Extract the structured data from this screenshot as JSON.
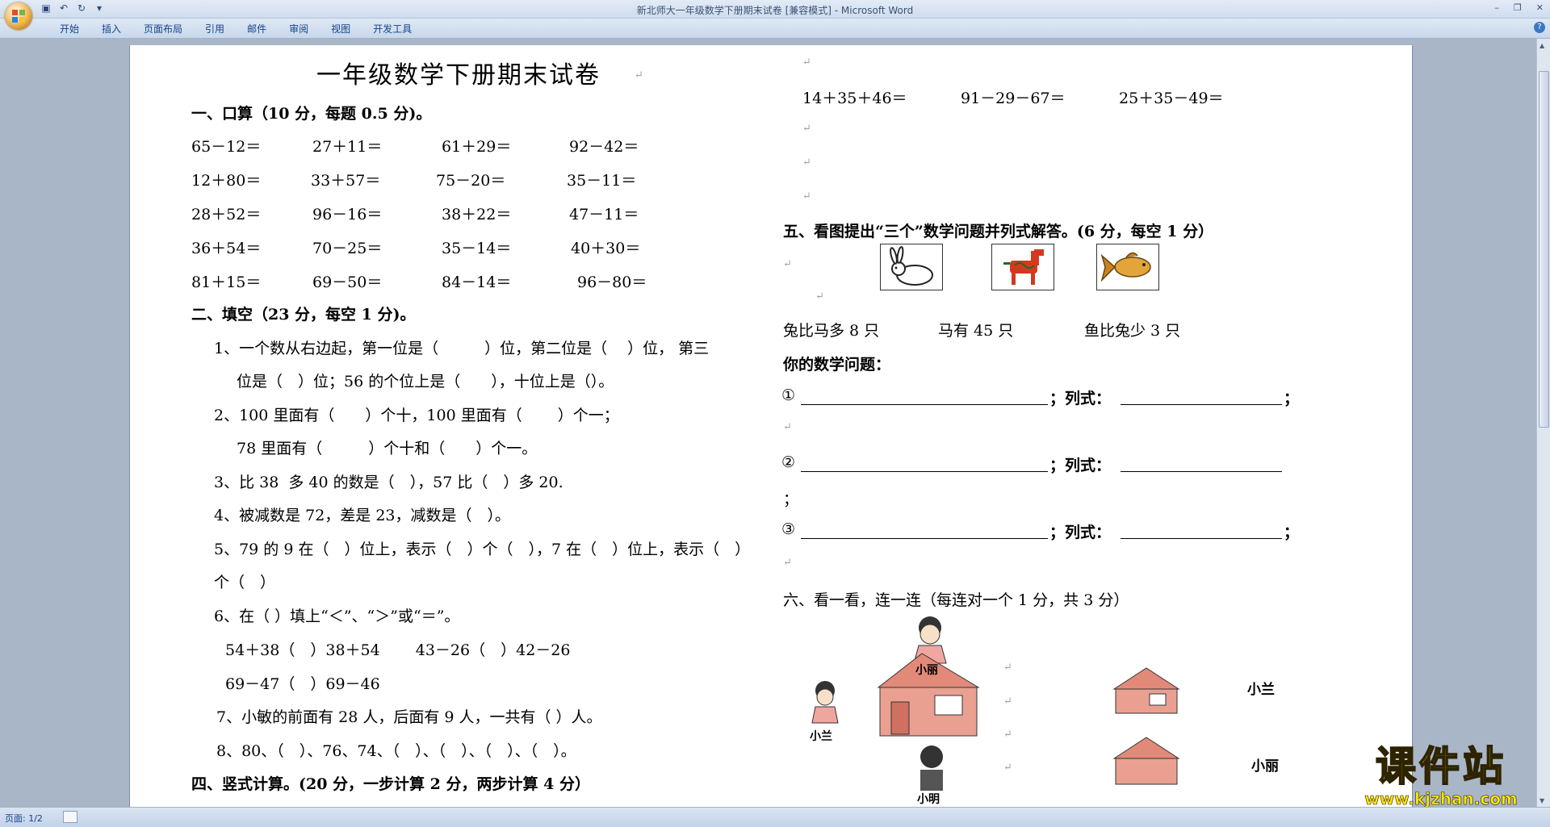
{
  "window": {
    "title": "新北师大一年级数学下册期末试卷 [兼容模式] - Microsoft Word"
  },
  "ribbon": {
    "tabs": [
      "开始",
      "插入",
      "页面布局",
      "引用",
      "邮件",
      "审阅",
      "视图",
      "开发工具"
    ]
  },
  "status": {
    "page": "页面: 1/2"
  },
  "doc": {
    "title": "一年级数学下册期末试卷",
    "s1_heading": "一、口算（10 分，每题 0.5 分)。",
    "s1_rows": [
      [
        "65－12＝",
        "27＋11＝",
        "61＋29＝",
        "92－42＝"
      ],
      [
        "12＋80＝",
        "33＋57＝",
        "75－20＝",
        "35－11＝"
      ],
      [
        "28＋52＝",
        "96－16＝",
        "38＋22＝",
        "47－11＝"
      ],
      [
        "36＋54＝",
        "70－25＝",
        "35－14＝",
        "40＋30＝"
      ],
      [
        "81＋15＝",
        "69－50＝",
        "84－14＝",
        "96－80＝"
      ]
    ],
    "s2_heading": "二、填空（23 分，每空 1 分)。",
    "s2_lines": [
      "1、一个数从右边起，第一位是（　　　）位，第二位是（　 ）位， 第三",
      "位是（　）位；56 的个位上是（　　），十位上是（）。",
      "2、100 里面有（　　）个十，100 里面有（　　 ）个一；",
      "78 里面有（　　　）个十和（　　）个一。",
      "3、比 38  多 40 的数是（　），57 比（　）多 20.",
      "4、被减数是 72，差是 23，减数是（　）。",
      "5、79 的 9 在（　）位上，表示（　）个（　），7 在（　）位上，表示（　）",
      "个（　）",
      "6、在（ ）填上“＜”、“＞”或“＝”。",
      "54＋38（　）38＋54　　 43－26（　）42－26",
      "69－47（　）69－46",
      "7、小敏的前面有 28 人，后面有 9 人，一共有（ ）人。",
      "8、80、（　）、76、74、（　）、（　）、（　）、（　）。"
    ],
    "s4_heading": "四、竖式计算。(20 分，一步计算 2 分，两步计算 4 分）",
    "s4_items": [
      "14＋35＋46＝",
      "91－29－67＝",
      "25＋35－49＝"
    ],
    "s5_heading": "五、看图提出“三个”数学问题并列式解答。(6 分，每空 1 分）",
    "s5_facts": [
      "兔比马多 8 只",
      "马有 45 只",
      "鱼比兔少 3 只"
    ],
    "s5_prompt": "你的数学问题：",
    "s5_markers": [
      "①",
      "②",
      "③"
    ],
    "s5_label": "；列式：",
    "s5_stray": "；",
    "s6_heading": "六、看一看，连一连（每连对一个 1 分，共 3 分）",
    "s6_names_left": [
      "小丽",
      "小兰",
      "小明"
    ],
    "s6_names_right": [
      "小兰",
      "小丽"
    ],
    "pilcrow": "↵"
  },
  "watermark": {
    "big": "课件站",
    "url": "www.kjzhan.com"
  }
}
